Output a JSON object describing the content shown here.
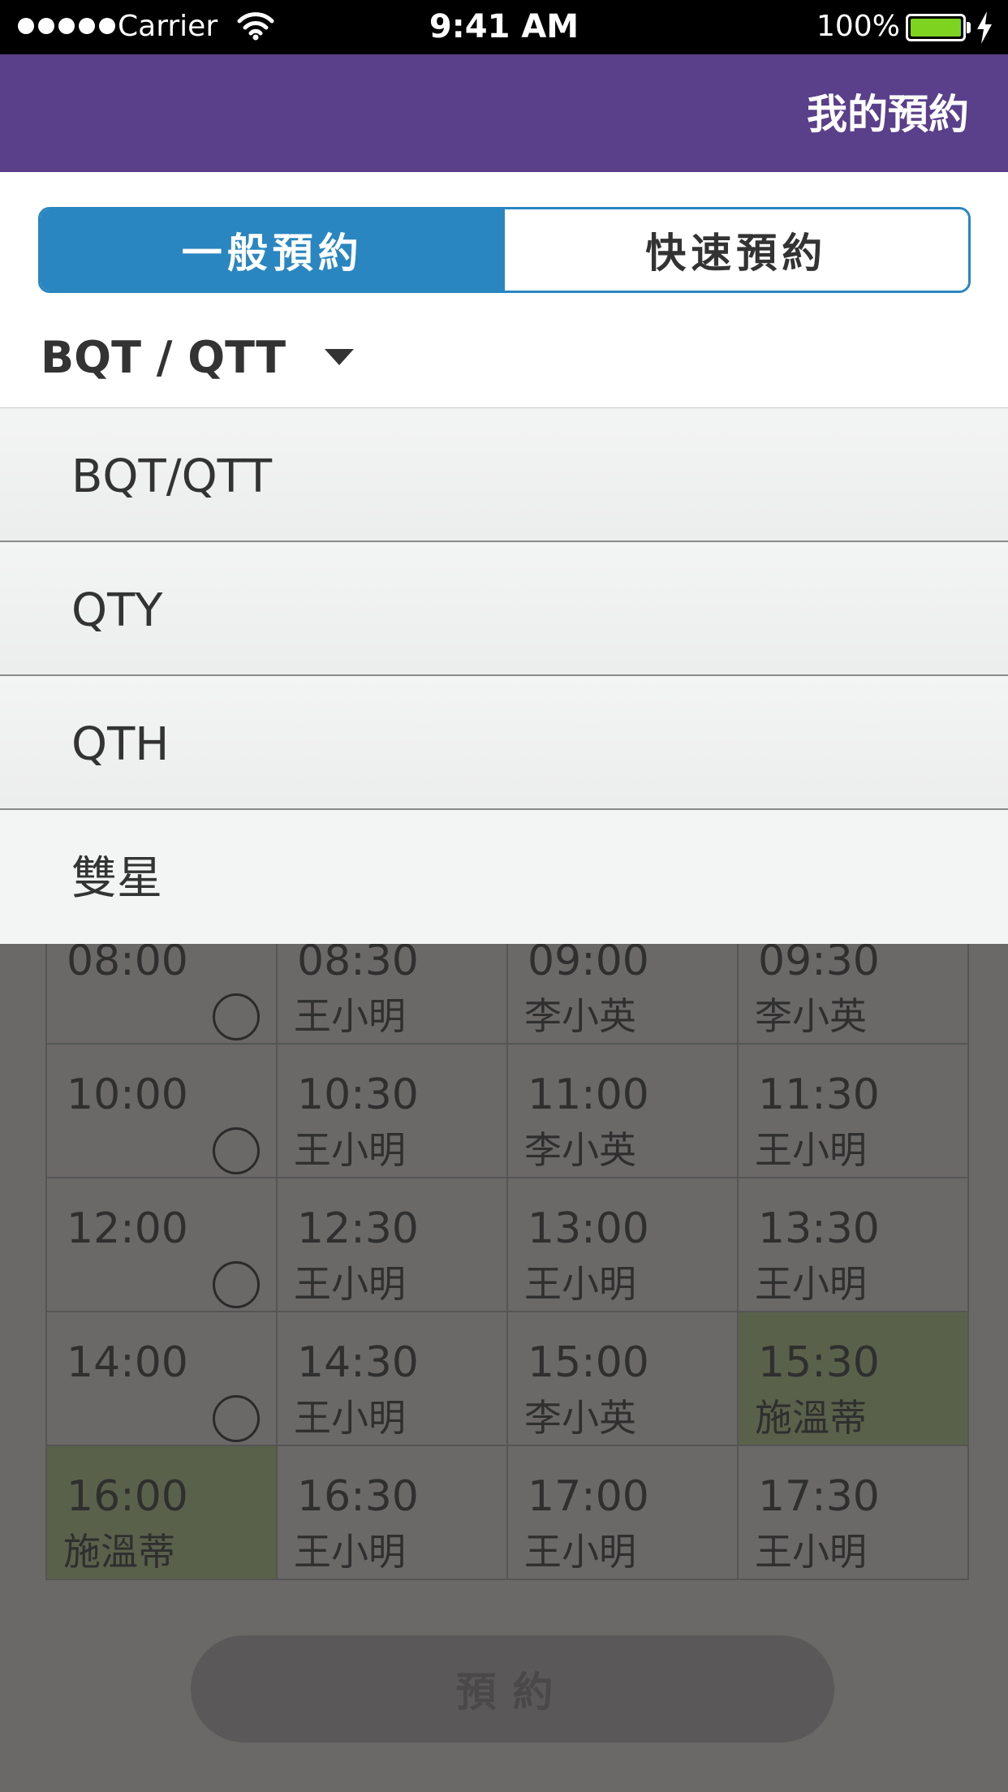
{
  "status_bar": {
    "carrier": "Carrier",
    "time": "9:41 AM",
    "battery": "100%"
  },
  "nav": {
    "title": "我的預約"
  },
  "segments": {
    "general": "一般預約",
    "quick": "快速預約"
  },
  "selector": {
    "value": "BQT / QTT"
  },
  "dropdown": {
    "options": [
      "BQT/QTT",
      "QTY",
      "QTH",
      "雙星"
    ]
  },
  "schedule": {
    "rows": [
      [
        {
          "time": "08:00",
          "name": "",
          "available": true
        },
        {
          "time": "08:30",
          "name": "王小明"
        },
        {
          "time": "09:00",
          "name": "李小英"
        },
        {
          "time": "09:30",
          "name": "李小英"
        }
      ],
      [
        {
          "time": "10:00",
          "name": "",
          "available": true
        },
        {
          "time": "10:30",
          "name": "王小明"
        },
        {
          "time": "11:00",
          "name": "李小英"
        },
        {
          "time": "11:30",
          "name": "王小明"
        }
      ],
      [
        {
          "time": "12:00",
          "name": "",
          "available": true
        },
        {
          "time": "12:30",
          "name": "王小明"
        },
        {
          "time": "13:00",
          "name": "王小明"
        },
        {
          "time": "13:30",
          "name": "王小明"
        }
      ],
      [
        {
          "time": "14:00",
          "name": "",
          "available": true
        },
        {
          "time": "14:30",
          "name": "王小明"
        },
        {
          "time": "15:00",
          "name": "李小英"
        },
        {
          "time": "15:30",
          "name": "施溫蒂",
          "highlight": true
        }
      ],
      [
        {
          "time": "16:00",
          "name": "施溫蒂",
          "highlight": true
        },
        {
          "time": "16:30",
          "name": "王小明"
        },
        {
          "time": "17:00",
          "name": "王小明"
        },
        {
          "time": "17:30",
          "name": "王小明"
        }
      ]
    ]
  },
  "book_button": "預約",
  "colors": {
    "nav": "#5a3f8a",
    "accent": "#2a86c1",
    "highlight": "#5a614a",
    "battery": "#7ed321"
  }
}
